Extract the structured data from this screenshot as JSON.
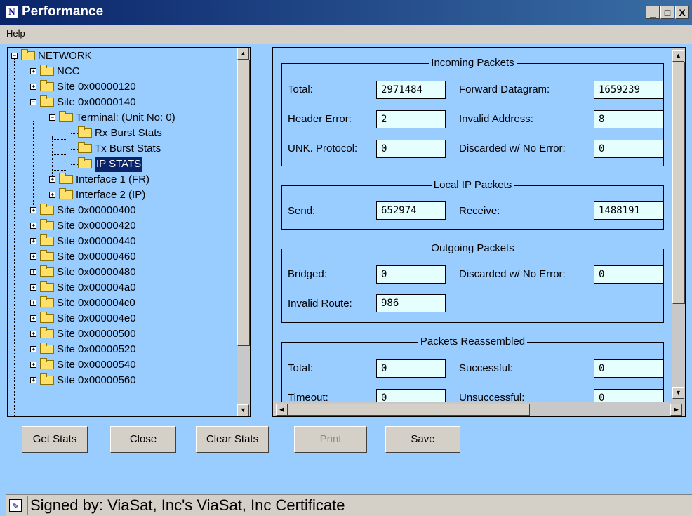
{
  "window": {
    "title": "Performance",
    "app_icon": "N",
    "minimize_label": "_",
    "maximize_label": "□",
    "close_label": "X"
  },
  "menu": {
    "help": "Help"
  },
  "tree": {
    "items": [
      {
        "label": "NETWORK",
        "expander": "−"
      },
      {
        "label": "NCC",
        "expander": "+"
      },
      {
        "label": "Site 0x00000120",
        "expander": "+"
      },
      {
        "label": "Site 0x00000140",
        "expander": "−"
      },
      {
        "label": "Terminal: (Unit No: 0)",
        "expander": "−"
      },
      {
        "label": "Rx Burst Stats"
      },
      {
        "label": "Tx Burst Stats"
      },
      {
        "label": "IP STATS",
        "selected": true
      },
      {
        "label": "Interface 1 (FR)",
        "expander": "+"
      },
      {
        "label": "Interface 2 (IP)",
        "expander": "+"
      },
      {
        "label": "Site 0x00000400",
        "expander": "+"
      },
      {
        "label": "Site 0x00000420",
        "expander": "+"
      },
      {
        "label": "Site 0x00000440",
        "expander": "+"
      },
      {
        "label": "Site 0x00000460",
        "expander": "+"
      },
      {
        "label": "Site 0x00000480",
        "expander": "+"
      },
      {
        "label": "Site 0x000004a0",
        "expander": "+"
      },
      {
        "label": "Site 0x000004c0",
        "expander": "+"
      },
      {
        "label": "Site 0x000004e0",
        "expander": "+"
      },
      {
        "label": "Site 0x00000500",
        "expander": "+"
      },
      {
        "label": "Site 0x00000520",
        "expander": "+"
      },
      {
        "label": "Site 0x00000540",
        "expander": "+"
      },
      {
        "label": "Site 0x00000560",
        "expander": "+"
      }
    ]
  },
  "stats": {
    "incoming": {
      "title": "Incoming Packets",
      "total_label": "Total:",
      "total": "2971484",
      "forward_label": "Forward Datagram:",
      "forward": "1659239",
      "header_error_label": "Header Error:",
      "header_error": "2",
      "invalid_address_label": "Invalid Address:",
      "invalid_address": "8",
      "unk_protocol_label": "UNK. Protocol:",
      "unk_protocol": "0",
      "discarded_label": "Discarded w/ No Error:",
      "discarded": "0"
    },
    "local": {
      "title": "Local IP Packets",
      "send_label": "Send:",
      "send": "652974",
      "receive_label": "Receive:",
      "receive": "1488191"
    },
    "outgoing": {
      "title": "Outgoing Packets",
      "bridged_label": "Bridged:",
      "bridged": "0",
      "discarded_label": "Discarded w/ No Error:",
      "discarded": "0",
      "invalid_route_label": "Invalid Route:",
      "invalid_route": "986"
    },
    "reassembled": {
      "title": "Packets Reassembled",
      "total_label": "Total:",
      "total": "0",
      "successful_label": "Successful:",
      "successful": "0",
      "timeout_label": "Timeout:",
      "timeout": "0",
      "unsuccessful_label": "Unsuccessful:",
      "unsuccessful": "0"
    }
  },
  "buttons": {
    "get_stats": "Get Stats",
    "close": "Close",
    "clear_stats": "Clear Stats",
    "print": "Print",
    "save": "Save"
  },
  "status": {
    "text": "Signed by: ViaSat, Inc's ViaSat, Inc Certificate"
  },
  "colors": {
    "background": "#99ccff",
    "field": "#e5ffff",
    "title_bar": "#0a246a",
    "selection": "#0a246a"
  }
}
